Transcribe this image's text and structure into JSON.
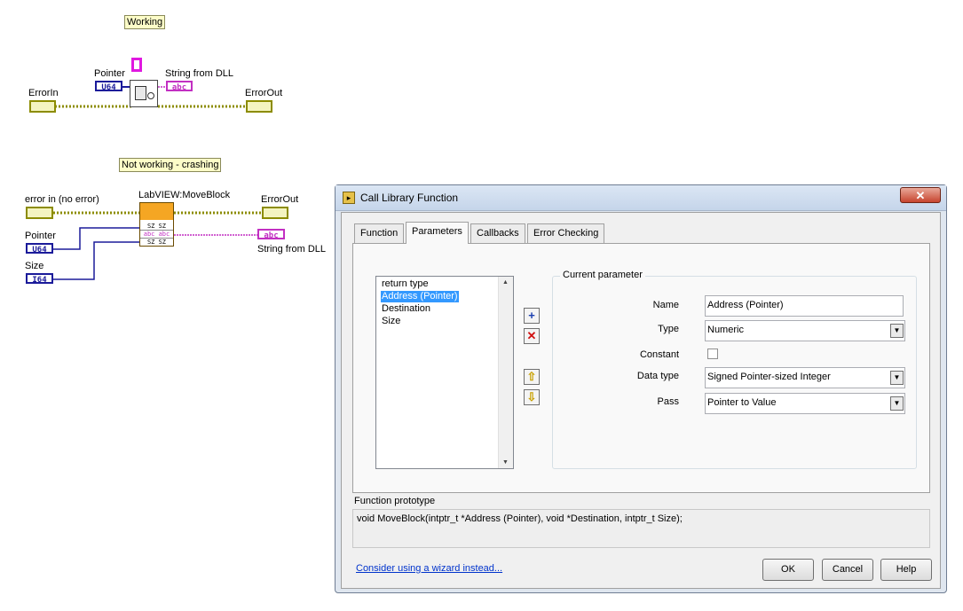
{
  "diagram": {
    "working_note": "Working",
    "not_working_note": "Not working - crashing",
    "top": {
      "pointer_label": "Pointer",
      "string_label": "String from DLL",
      "error_in_label": "ErrorIn",
      "error_out_label": "ErrorOut",
      "u64": "U64",
      "abc": "abc"
    },
    "bottom": {
      "error_in_label": "error in (no error)",
      "node_label": "LabVIEW:MoveBlock",
      "error_out_label": "ErrorOut",
      "pointer_label": "Pointer",
      "size_label": "Size",
      "string_label": "String from DLL",
      "u64": "U64",
      "i64": "I64",
      "abc": "abc"
    }
  },
  "dialog": {
    "title": "Call Library Function",
    "close_glyph": "✕",
    "tabs": [
      "Function",
      "Parameters",
      "Callbacks",
      "Error Checking"
    ],
    "active_tab": "Parameters",
    "param_list": [
      "return type",
      "Address (Pointer)",
      "Destination",
      "Size"
    ],
    "selected_param": "Address (Pointer)",
    "current_param": {
      "group_title": "Current parameter",
      "name_label": "Name",
      "name_value": "Address (Pointer)",
      "type_label": "Type",
      "type_value": "Numeric",
      "constant_label": "Constant",
      "data_type_label": "Data type",
      "data_type_value": "Signed Pointer-sized Integer",
      "pass_label": "Pass",
      "pass_value": "Pointer to Value"
    },
    "prototype_label": "Function prototype",
    "prototype_text": "void  MoveBlock(intptr_t *Address (Pointer), void *Destination, intptr_t Size);",
    "wizard_link": "Consider using a wizard instead...",
    "buttons": {
      "ok": "OK",
      "cancel": "Cancel",
      "help": "Help"
    }
  }
}
